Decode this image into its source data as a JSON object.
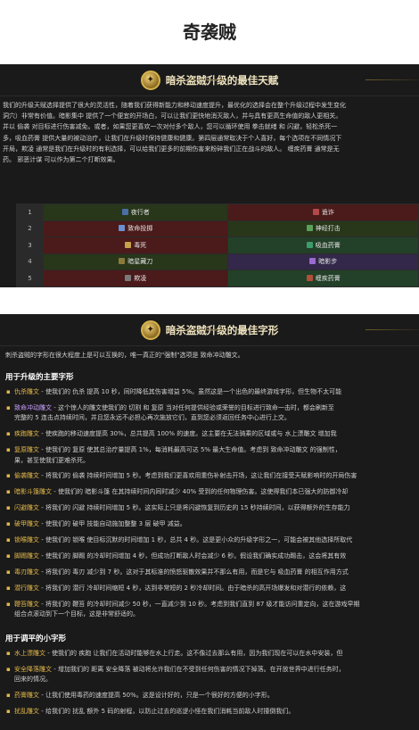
{
  "page": {
    "title": "奇袭贼"
  },
  "talents_section": {
    "title": "暗杀盗贼升级的最佳天赋",
    "intro_lines": [
      "我们的升级天赋选择提供了很大的灵活性，随着我们获得新能力和移动速度提升，最优化的选择会在整个升级过程中发生变化",
      "洞穴）非常有价值。暗影集中 提供了一个便宜的开场白，可以让我们更快地消灭敌人，并与具有更高生命值的敌人更相关。",
      "并以 偷袭 对目标进行伤害减免。或者，如果您更喜欢一次对付多个敌人，您可以循环使用 拳击就绪 和 闪避，轻松杀死一",
      "多，吸血药膏 提供大量的被动治疗，让我们在升级时保持健康和健康。第四层通常取决于个人喜好，每个选项在不同情况下",
      "开局，欺凌 通常是我们在升级时的有利选择，可以给我们更多的前期伤害来粉碎我们正在战斗的敌人。 缠疾药膏 通常是无",
      "药。 邪恶计谋 可以作为第二个打断效果。"
    ],
    "table": {
      "rows": [
        {
          "level": "1",
          "left": "夜行者",
          "right": "诡诈"
        },
        {
          "level": "2",
          "left": "致命投掷",
          "right": "神经打击"
        },
        {
          "level": "3",
          "left": "毒死",
          "right": "吸血药膏"
        },
        {
          "level": "4",
          "left": "暗星藏刀",
          "right": "暗影步"
        },
        {
          "level": "5",
          "left": "欺凌",
          "right": "缠疾药膏"
        }
      ]
    }
  },
  "glyphs_section": {
    "title": "暗杀盗贼升级的最佳字形",
    "note": "刺杀盗贼的字形在很大程度上是可以互换的，唯一真正的\"强制\"选项是 致命冲动雕文。",
    "major_heading": "用于升级的主要字形",
    "major": [
      {
        "name": "仇杀雕文",
        "text": " - 使我们的 仇杀 提高 10 秒，同时降低其伤害增益 5%。虽然这是一个出色的最终游戏字形，但生物不太可能"
      },
      {
        "name": "致命冲动雕文",
        "text": " - 这个惊人的雕文使我们的 切割 和 复原 当对任何提供经验或荣誉的目标进行致命一击时，都会刷新至",
        "cont": "完整的 5 连击点持续时间，并且您永远不必担心再次施放它们，直到您必须返回任务中心进行上交。"
      },
      {
        "name": "疾跑雕文",
        "text": " - 使疾跑的移动速度提高 30%，总共提高 100% 的速度。这主要在无法骑乘的区域或与 水上漂雕文 增加我"
      },
      {
        "name": "复原雕文",
        "text": " - 使我们的 复原 使其总治疗量提高 1%，每消耗最高可达 5% 最大生命值。考虑到 致命冲动雕文 的强制性，",
        "cont": "果，甚至使我们更难杀死。"
      },
      {
        "name": "偷袭雕文",
        "text": " - 将我们的 偷袭 持续时间增加 5 秒。考虑到我们更喜欢用重伤补射击开场，这让我们在接受天赋影响时的开局伤害"
      },
      {
        "name": "暗影斗篷雕文",
        "text": " - 使我们的 暗影斗篷 在其持续时间内同时减少 40% 受到的任何物理伤害。这使得我们本已强大的防御冷却"
      },
      {
        "name": "闪避雕文",
        "text": " - 将我们的 闪避 持续时间增加 5 秒。这实际上只是将闪避恢复到历史的 15 秒持续时间，以获得额外的生存能力"
      },
      {
        "name": "破甲雕文",
        "text": " - 使我们的 破甲 技能自动施加整整 3 层 破甲 减益。"
      },
      {
        "name": "锁喉雕文",
        "text": " - 使我们的 锁喉 使目标沉默的时间增加 1 秒，总共 4 秒。这是更小众的升级字形之一，可能会被其他选择所取代"
      },
      {
        "name": "脚踢雕文",
        "text": " - 使我们的 脚踢 的冷却时间增加 4 秒，但成功打断敌人时会减少 6 秒。假设我们确实成功踢击，这会将其有效"
      },
      {
        "name": "毒刃雕文",
        "text": " - 将我们的 毒刃 减少到 7 秒。这对于其标准的愤怒驱散效果并不那么有用，而是它与 吸血药膏 的相互作用方式"
      },
      {
        "name": "潜行雕文",
        "text": " - 将我们的 潜行 冷却时间缩短 4 秒，达到非常短的 2 秒冷却时间。由于暗杀的高开场爆发和对潜行的依赖，这"
      },
      {
        "name": "鞭笞雕文",
        "text": " - 将我们的 鞭笞 的冷却时间减少 50 秒，一直减少到 10 秒。考虑到我们直到 87 级才能访问重定向，这在游戏早期",
        "cont": "组合点滚动到下一个目标，这是非常舒适的。"
      }
    ],
    "minor_heading": "用于调平的小字形",
    "minor": [
      {
        "name": "水上漂雕文",
        "text": " - 使我们的 疾跑 让我们在活动时能够在水上行走。这不像过去那么有用，因为我们现在可以在水中安装，但"
      },
      {
        "name": "安全降落雕文",
        "text": " - 增加我们的 距离 安全降落 被动将允许我们在不受到任何伤害的情况下掉落。在开放世界中进行任务时，",
        "cont": "回来的情况。"
      },
      {
        "name": "药膏雕文",
        "text": " - 让我们使用毒药的速度提高 50%。这是设计好的，只是一个很好的方便的小字形。"
      },
      {
        "name": "扰乱雕文",
        "text": " - 给我们的 扰乱 额外 5 码的射程，以防止过去的巡逻小怪在我们消耗当前敌人时撞倒我们。"
      }
    ]
  },
  "colors": {
    "panel_bg": "#1a1a1a",
    "accent_gold": "#e2b84a",
    "accent_purple": "#c9a0ff"
  }
}
